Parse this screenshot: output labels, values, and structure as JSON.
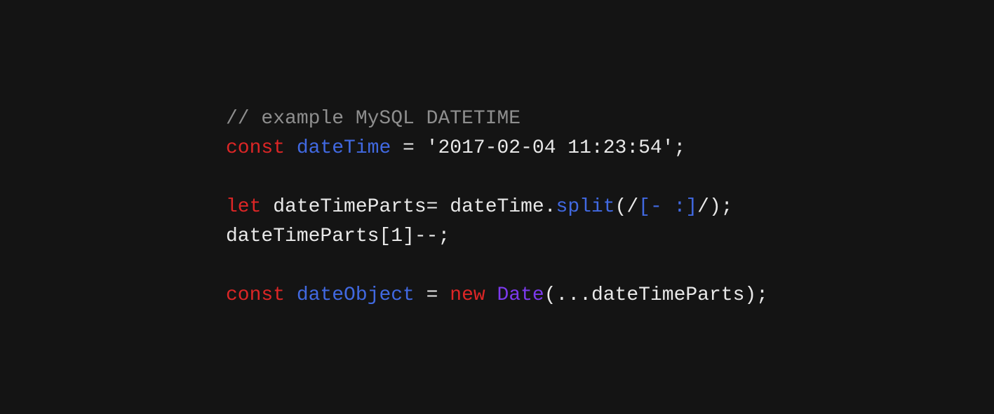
{
  "code": {
    "line1": {
      "comment": "// example MySQL DATETIME"
    },
    "line2": {
      "const": "const",
      "varName": "dateTime",
      "equals": " = ",
      "string": "'2017-02-04 11:23:54'",
      "semi": ";"
    },
    "line3": {
      "empty": ""
    },
    "line4": {
      "let": "let",
      "varName": " dateTimeParts",
      "equals": "= ",
      "obj": "dateTime.",
      "method": "split",
      "parenOpen": "(/",
      "regexBracket": "[- :]",
      "parenClose": "/);"
    },
    "line5": {
      "text": "dateTimeParts[",
      "num": "1",
      "rest": "]--;"
    },
    "line6": {
      "empty": ""
    },
    "line7": {
      "const": "const",
      "varName": "dateObject",
      "equals": " = ",
      "newKw": "new",
      "space": " ",
      "className": "Date",
      "rest": "(...dateTimeParts);"
    }
  }
}
